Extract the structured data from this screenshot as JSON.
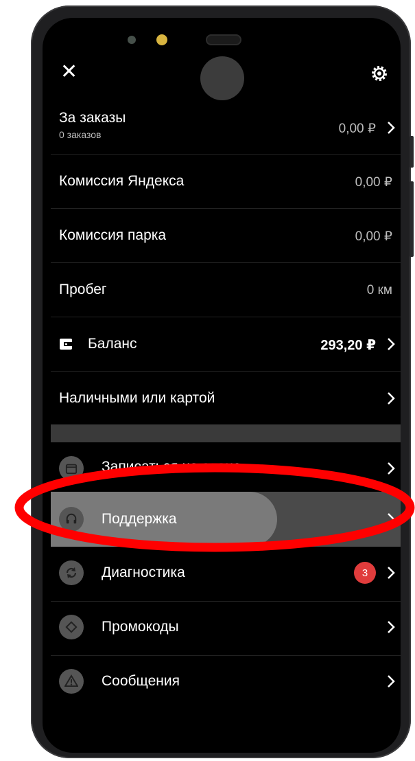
{
  "header": {
    "close_glyph": "✕",
    "settings_icon": "gear-icon"
  },
  "stats": {
    "orders": {
      "label": "За заказы",
      "sub": "0 заказов",
      "value": "0,00 ₽"
    },
    "yandex_commission": {
      "label": "Комиссия Яндекса",
      "value": "0,00 ₽"
    },
    "park_commission": {
      "label": "Комиссия парка",
      "value": "0,00 ₽"
    },
    "mileage": {
      "label": "Пробег",
      "value": "0 км"
    },
    "balance": {
      "label": "Баланс",
      "value": "293,20 ₽"
    },
    "payment": {
      "label": "Наличными или картой"
    }
  },
  "menu": {
    "schedule": {
      "label": "Записаться на сеанс",
      "icon": "calendar-icon"
    },
    "support": {
      "label": "Поддержка",
      "icon": "headset-icon"
    },
    "diagnostics": {
      "label": "Диагностика",
      "badge": "3",
      "icon": "refresh-icon"
    },
    "promocodes": {
      "label": "Промокоды",
      "icon": "tag-icon"
    },
    "messages": {
      "label": "Сообщения",
      "icon": "warning-icon"
    }
  },
  "colors": {
    "background": "#000000",
    "highlight": "#7a7a7a",
    "badge": "#e03c3c",
    "annotation": "#ff0000"
  }
}
